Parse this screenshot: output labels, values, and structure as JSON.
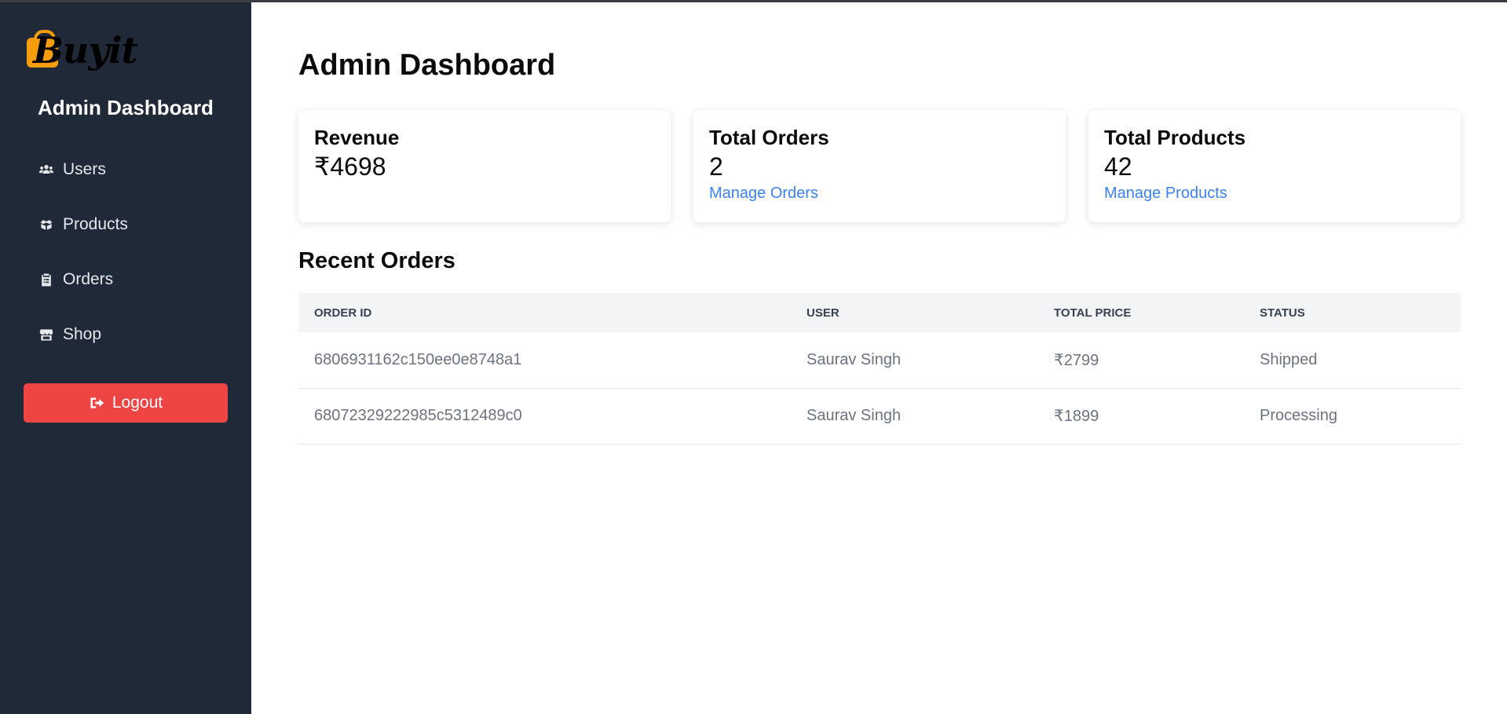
{
  "brand": {
    "logo_text": "Buyit"
  },
  "sidebar": {
    "title": "Admin Dashboard",
    "items": [
      {
        "label": "Users",
        "icon": "users-icon"
      },
      {
        "label": "Products",
        "icon": "boxes-icon"
      },
      {
        "label": "Orders",
        "icon": "clipboard-list-icon"
      },
      {
        "label": "Shop",
        "icon": "store-icon"
      }
    ],
    "logout_label": "Logout"
  },
  "main": {
    "title": "Admin Dashboard",
    "cards": [
      {
        "title": "Revenue",
        "value": "₹4698",
        "link": ""
      },
      {
        "title": "Total Orders",
        "value": "2",
        "link": "Manage Orders"
      },
      {
        "title": "Total Products",
        "value": "42",
        "link": "Manage Products"
      }
    ],
    "recent_orders": {
      "title": "Recent Orders",
      "columns": [
        "Order ID",
        "User",
        "Total Price",
        "Status"
      ],
      "rows": [
        [
          "6806931162c150ee0e8748a1",
          "Saurav Singh",
          "₹2799",
          "Shipped"
        ],
        [
          "68072329222985c5312489c0",
          "Saurav Singh",
          "₹1899",
          "Processing"
        ]
      ]
    }
  },
  "colors": {
    "sidebar_bg": "#1f2937",
    "logout_bg": "#ef4444",
    "link": "#3b82f6",
    "logo_bag": "#f59e0b"
  }
}
